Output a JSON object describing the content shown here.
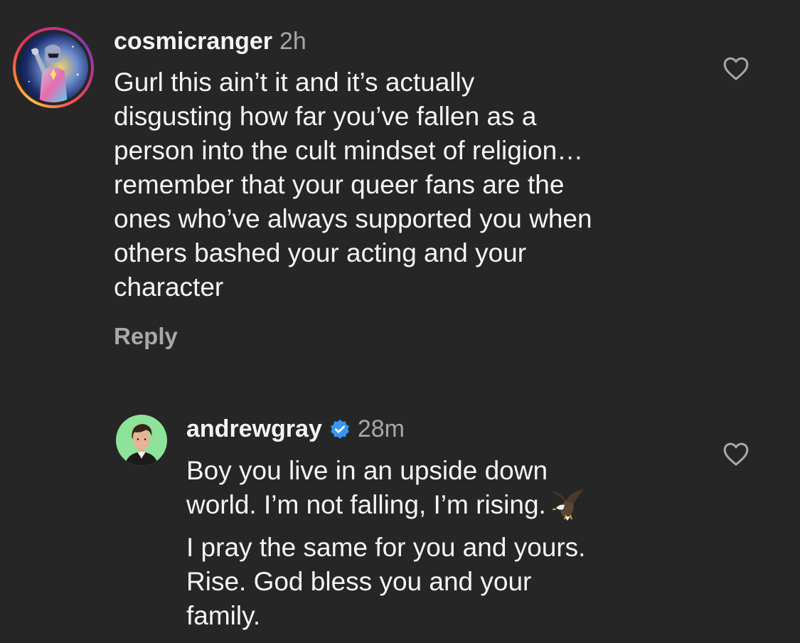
{
  "comments": [
    {
      "username": "cosmicranger",
      "time": "2h",
      "text": "Gurl this ain’t it and it’s actually\ndisgusting how far you’ve fallen as a\nperson into the cult mindset of religion…\nremember that your queer fans are the\nones who’ve always supported you when\nothers bashed your acting and your\ncharacter",
      "reply_label": "Reply",
      "avatar_icon": "masked-hero-avatar",
      "like_icon": "heart-outline-icon"
    },
    {
      "username": "andrewgray",
      "verified": true,
      "verified_icon": "verified-badge-icon",
      "time": "28m",
      "text_line1": "Boy you live in an upside down",
      "text_line2": "world. I’m not falling, I’m rising.",
      "emoji_icon": "eagle-emoji-icon",
      "text_para2": "I pray the same for you and yours.\nRise. God bless you and your\nfamily.",
      "avatar_icon": "profile-photo-avatar",
      "like_icon": "heart-outline-icon"
    }
  ],
  "colors": {
    "background": "#262626",
    "primary_text": "#f5f5f5",
    "secondary_text": "#a8a8a8",
    "verified_blue": "#3797f0",
    "avatar_green": "#8ee39a"
  }
}
